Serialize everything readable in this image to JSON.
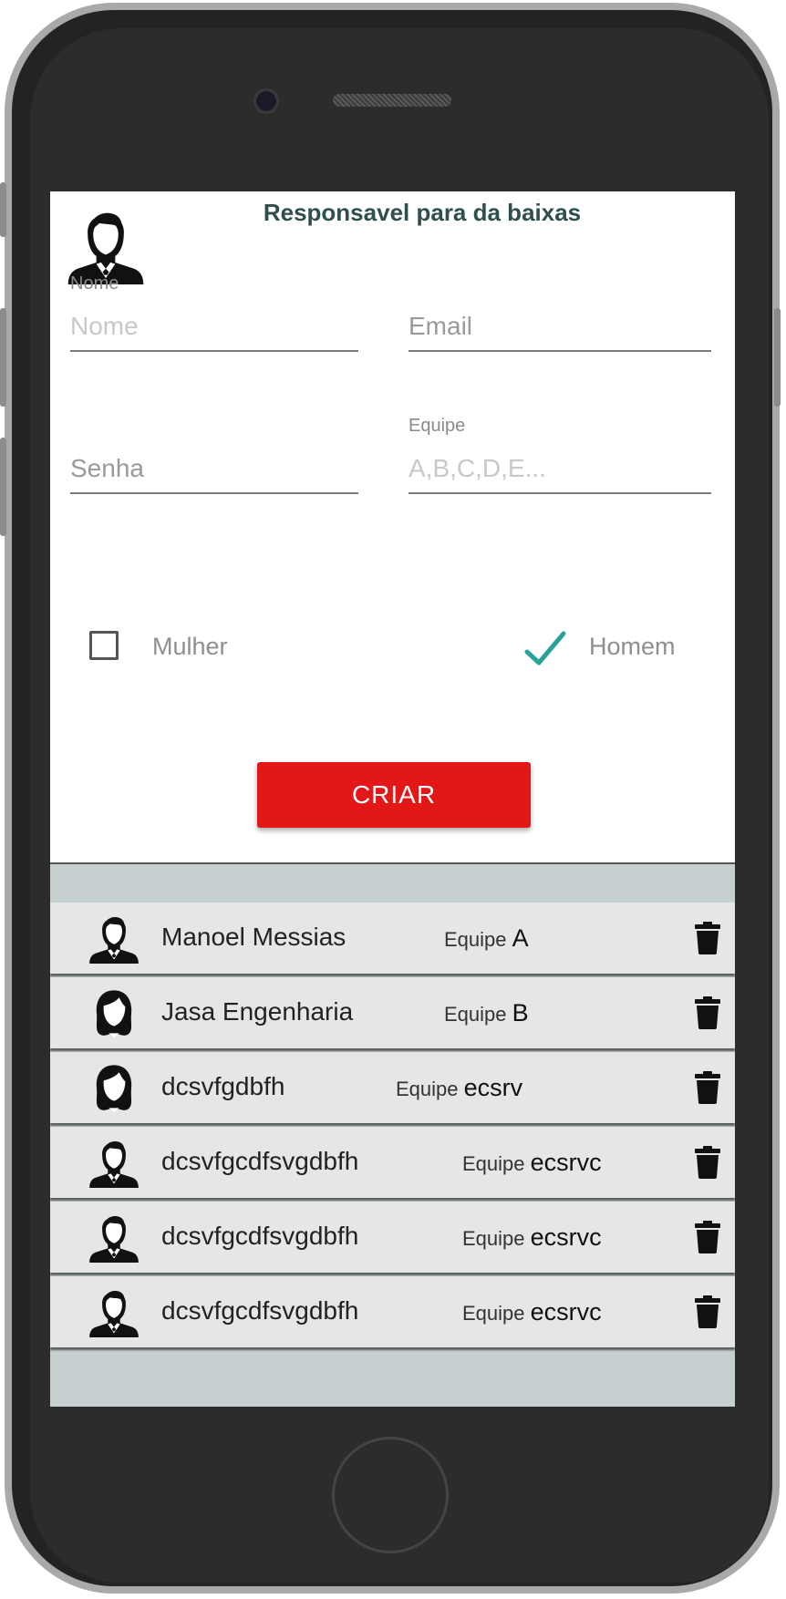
{
  "header": {
    "title": "Responsavel para da baixas"
  },
  "form": {
    "nome": {
      "label": "Nome",
      "placeholder": "Nome"
    },
    "email": {
      "placeholder": "Email"
    },
    "senha": {
      "placeholder": "Senha"
    },
    "equipe": {
      "label": "Equipe",
      "placeholder": "A,B,C,D,E..."
    },
    "gender": {
      "mulher_label": "Mulher",
      "homem_label": "Homem",
      "selected": "Homem"
    },
    "submit_label": "CRIAR"
  },
  "list": {
    "team_prefix": "Equipe",
    "items": [
      {
        "name": "Manoel Messias",
        "team": "A",
        "avatar": "male-avatar-icon"
      },
      {
        "name": "Jasa Engenharia",
        "team": "B",
        "avatar": "female-avatar-icon"
      },
      {
        "name": "dcsvfgdbfh",
        "team": "ecsrv",
        "avatar": "female-avatar-icon"
      },
      {
        "name": "dcsvfgcdfsvgdbfh",
        "team": "ecsrvc",
        "avatar": "male-avatar-icon"
      },
      {
        "name": "dcsvfgcdfsvgdbfh",
        "team": "ecsrvc",
        "avatar": "male-avatar-icon"
      },
      {
        "name": "dcsvfgcdfsvgdbfh",
        "team": "ecsrvc",
        "avatar": "male-avatar-icon"
      }
    ]
  },
  "colors": {
    "accent": "#e31717",
    "check": "#2aa198",
    "list_bg": "#c7d0d0",
    "row_bg": "#e6e6e6"
  }
}
